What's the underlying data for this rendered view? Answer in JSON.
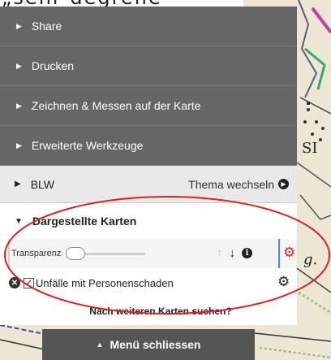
{
  "top_fragment": "„sehr degrelle",
  "menu": {
    "items": [
      {
        "label": "Share"
      },
      {
        "label": "Drucken"
      },
      {
        "label": "Zeichnen & Messen auf der Karte"
      },
      {
        "label": "Erweiterte Werkzeuge"
      }
    ],
    "topic": {
      "name": "BLW",
      "change_label": "Thema wechseln"
    },
    "layers": {
      "heading": "Dargestellte Karten",
      "transparency_label": "Transparenz",
      "transparency_value": 0,
      "layer_name": "Unfälle mit Personenschaden",
      "layer_checked": true
    },
    "search_link": "Nach weiteren Karten suchen?",
    "close_label": "Menü schliessen"
  },
  "map_labels": {
    "label_s": "SI",
    "label_g": "g."
  },
  "colors": {
    "panel_dark": "#666666",
    "accent_red": "#e02020",
    "separator_blue": "#4a8bd6",
    "annotation": "#e02020"
  },
  "icons": [
    "caret-right-icon",
    "caret-down-icon",
    "circle-arrow-right-icon",
    "arrow-up-icon",
    "arrow-down-icon",
    "info-icon",
    "gear-icon",
    "remove-icon",
    "checkbox-icon",
    "caret-up-icon"
  ]
}
